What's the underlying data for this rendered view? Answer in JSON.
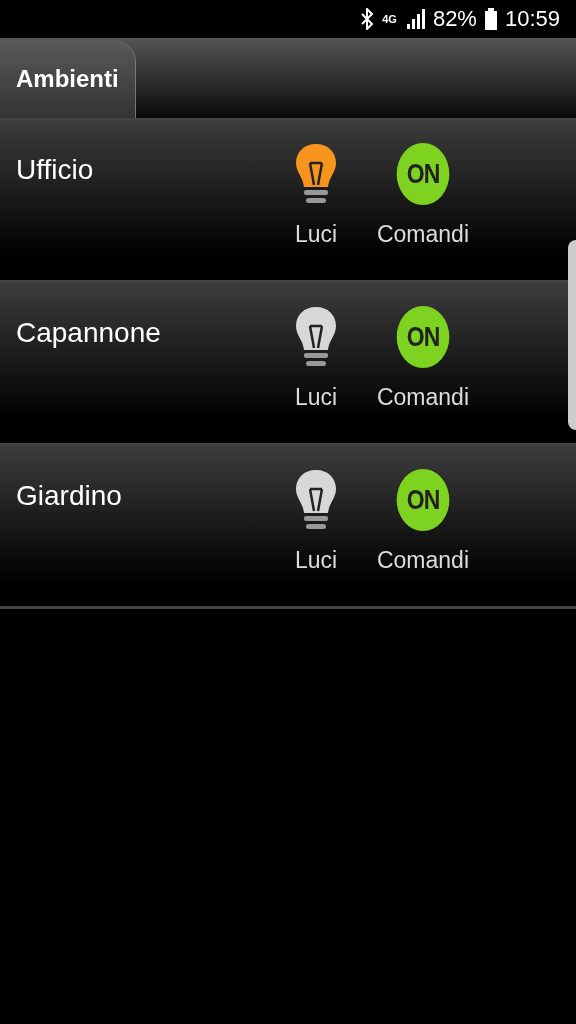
{
  "status_bar": {
    "network": "4G",
    "battery": "82%",
    "time": "10:59"
  },
  "tabs": [
    {
      "label": "Ambienti",
      "selected": true
    }
  ],
  "rooms": [
    {
      "name": "Ufficio",
      "lights_on": true,
      "lights_label": "Luci",
      "commands_badge": "ON",
      "commands_label": "Comandi"
    },
    {
      "name": "Capannone",
      "lights_on": false,
      "lights_label": "Luci",
      "commands_badge": "ON",
      "commands_label": "Comandi"
    },
    {
      "name": "Giardino",
      "lights_on": false,
      "lights_label": "Luci",
      "commands_badge": "ON",
      "commands_label": "Comandi"
    }
  ]
}
